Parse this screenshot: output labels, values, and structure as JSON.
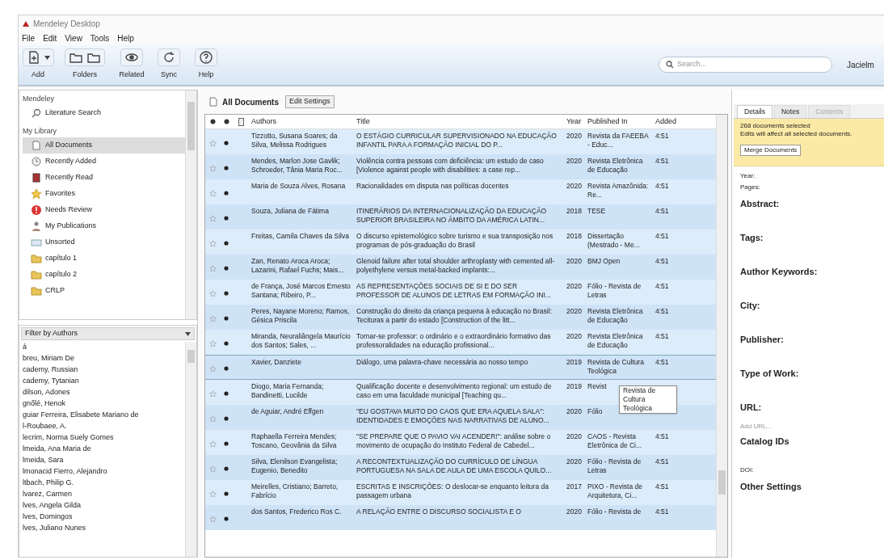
{
  "window": {
    "title": "Mendeley Desktop"
  },
  "menu": [
    "File",
    "Edit",
    "View",
    "Tools",
    "Help"
  ],
  "toolbar": [
    {
      "label": "Add",
      "kind": "add",
      "dropdown": true
    },
    {
      "label": "Folders",
      "kind": "folders"
    },
    {
      "label": "Related",
      "kind": "related"
    },
    {
      "label": "Sync",
      "kind": "sync"
    },
    {
      "label": "Help",
      "kind": "help"
    }
  ],
  "search": {
    "placeholder": "Search..."
  },
  "user": "Jacielm",
  "sidebar": {
    "sections": [
      {
        "title": "Mendeley",
        "items": [
          {
            "label": "Literature Search",
            "kind": "search",
            "selected": false
          }
        ]
      },
      {
        "title": "My Library",
        "items": [
          {
            "label": "All Documents",
            "kind": "docs",
            "selected": true
          },
          {
            "label": "Recently Added",
            "kind": "clock",
            "selected": false
          },
          {
            "label": "Recently Read",
            "kind": "book",
            "selected": false
          },
          {
            "label": "Favorites",
            "kind": "star",
            "selected": false
          },
          {
            "label": "Needs Review",
            "kind": "review",
            "selected": false
          },
          {
            "label": "My Publications",
            "kind": "person",
            "selected": false
          },
          {
            "label": "Unsorted",
            "kind": "unsorted",
            "selected": false
          },
          {
            "label": "capítulo 1",
            "kind": "folder",
            "selected": false
          },
          {
            "label": "capítulo 2",
            "kind": "folder",
            "selected": false
          },
          {
            "label": "CRLP",
            "kind": "folder",
            "selected": false
          }
        ]
      }
    ]
  },
  "filter": {
    "label": "Filter by Authors",
    "items": [
      "á",
      "breu, Miriam De",
      "cademy, Russian",
      "cademy, Tytanian",
      "dilson, Adones",
      "gnőlé, Henok",
      "guiar Ferreira, Elisabete Mariano de",
      "l-Roubaee, A.",
      "lecrim, Norma Suely Gomes",
      "lmeida, Ana Maria de",
      "lmeida, Sara",
      "lmonacid Fierro, Alejandro",
      "ltbach, Philip G.",
      "lvarez, Carmen",
      "lves, Angela Gilda",
      "lves, Domingos",
      "lves, Juliano Nunes"
    ]
  },
  "documents": {
    "title": "All Documents",
    "edit_button": "Edit Settings",
    "columns": [
      "Authors",
      "Title",
      "Year",
      "Published In",
      "Added"
    ],
    "rows": [
      {
        "selected": true,
        "hovered": false,
        "authors": "Tizzotto, Susana Soares; da Silva, Melissa Rodrigues",
        "title": "O ESTÁGIO CURRICULAR SUPERVISIONADO NA EDUCAÇÃO INFANTIL PARA A FORMAÇÃO INICIAL DO P...",
        "year": "2020",
        "published": "Revista da FAEEBA - Educ...",
        "added": "4:51"
      },
      {
        "selected": true,
        "hovered": false,
        "authors": "Mendes, Marlon Jose Gavlik; Schroeder, Tânia Maria Roc...",
        "title": "Violência contra pessoas com deficiência: um estudo de caso [Violence against people with disabilities: a case rep...",
        "year": "2020",
        "published": "Revista Eletrônica de Educação",
        "added": "4:51"
      },
      {
        "selected": true,
        "hovered": false,
        "authors": "Maria de Souza Alves, Rosana",
        "title": "Racionalidades em disputa nas políticas docentes",
        "year": "2020",
        "published": "Revista Amazônida: Re...",
        "added": "4:51"
      },
      {
        "selected": true,
        "hovered": false,
        "authors": "Souza, Juliana de Fátima",
        "title": "ITINERÁRIOS DA INTERNACIONALIZAÇÃO DA EDUCAÇÃO SUPERIOR BRASILEIRA NO ÂMBITO DA AMÉRICA LATIN...",
        "year": "2018",
        "published": "TESE",
        "added": "4:51"
      },
      {
        "selected": true,
        "hovered": false,
        "authors": "Freitas, Camila Chaves da Silva",
        "title": "O discurso epistemológico sobre turismo e sua transposição nos programas de pós-graduação do Brasil",
        "year": "2018",
        "published": "Dissertação (Mestrado - Me...",
        "added": "4:51"
      },
      {
        "selected": true,
        "hovered": false,
        "authors": "Zan, Renato Aroca Aroca; Lazarini, Rafael Fuchs; Mais...",
        "title": "Glenoid failure after total shoulder arthroplasty with cemented all-polyethylene versus metal-backed implants:...",
        "year": "2020",
        "published": "BMJ Open",
        "added": "4:51"
      },
      {
        "selected": true,
        "hovered": false,
        "authors": "de França, José Marcos Ernesto Santana; Ribeiro, P...",
        "title": "AS REPRESENTAÇÕES SOCIAIS DE SI E DO SER PROFESSOR DE ALUNOS DE LETRAS EM FORMAÇÃO INI...",
        "year": "2020",
        "published": "Fólio - Revista de Letras",
        "added": "4:51"
      },
      {
        "selected": true,
        "hovered": false,
        "authors": "Peres, Nayane Moreno; Ramos, Gésica Priscila",
        "title": "Construção do direito da criança pequena à educação no Brasil: Tecituras a partir do estado [Construction of the litt...",
        "year": "2020",
        "published": "Revista Eletrônica de Educação",
        "added": "4:51"
      },
      {
        "selected": true,
        "hovered": false,
        "authors": "Miranda, Neuraliângela Maurício dos Santos; Sales, ...",
        "title": "Tornar-se professor: o ordinário e o extraordinário formativo das professoralidades na educação profissional...",
        "year": "2020",
        "published": "Revista Eletrônica de Educação",
        "added": "4:51"
      },
      {
        "selected": true,
        "hovered": true,
        "authors": "Xavier, Danziete",
        "title": "Diálogo, uma palavra-chave necessária ao nosso tempo",
        "year": "2019",
        "published": "Revista de Cultura Teológica",
        "added": "4:51"
      },
      {
        "selected": true,
        "hovered": false,
        "authors": "Diogo, Maria Fernanda; Bandinetti, Lucilde",
        "title": "Qualificação docente e desenvolvimento regional: um estudo de caso em uma faculdade municipal [Teaching qu...",
        "year": "2019",
        "published": "Revist",
        "tooltip": "Revista de Cultura Teológica"
      },
      {
        "selected": true,
        "hovered": false,
        "authors": "de Aguiar, André Effgen",
        "title": "\"EU GOSTAVA MUITO DO CAOS QUE ERA AQUELA SALA\": IDENTIDADES E EMOÇÕES NAS NARRATIVAS DE ALUNO...",
        "year": "2020",
        "published": "Fólio"
      },
      {
        "selected": true,
        "hovered": false,
        "authors": "Raphaella Ferreira Mendes; Toscano, Geovânia da Silva",
        "title": "\"SE PREPARE QUE O PAVIO VAI ACENDER!\": análise sobre o movimento de ocupação do Instituto Federal de Cabedel...",
        "year": "2020",
        "published": "CAOS - Revista Eletrônica de Ci...",
        "added": "4:51"
      },
      {
        "selected": true,
        "hovered": false,
        "authors": "Silva, Elenilson Evangelista; Eugenio, Benedito",
        "title": "A RECONTEXTUALIZAÇÃO DO CURRÍCULO DE LÍNGUA PORTUGUESA NA SALA DE AULA DE UMA ESCOLA QUILO...",
        "year": "2020",
        "published": "Fólio - Revista de Letras",
        "added": "4:51"
      },
      {
        "selected": true,
        "hovered": false,
        "authors": "Meirelles, Cristiano; Barreto, Fabrício",
        "title": "ESCRITAS E INSCRIÇÕES: O deslocar-se enquanto leitura da passagem urbana",
        "year": "2017",
        "published": "PIXO - Revista de Arquitetura, Ci...",
        "added": "4:51"
      },
      {
        "selected": true,
        "hovered": false,
        "authors": "dos Santos, Frederico Ros C.",
        "title": "A RELAÇÃO ENTRE O DISCURSO SOCIALISTA E O",
        "year": "2020",
        "published": "Fólio - Revista de",
        "added": "4:51"
      }
    ]
  },
  "details": {
    "tabs": [
      {
        "label": "Details",
        "selected": true,
        "disabled": false
      },
      {
        "label": "Notes",
        "selected": false,
        "disabled": false
      },
      {
        "label": "Contents",
        "selected": false,
        "disabled": true
      }
    ],
    "notice": [
      "268 documents selected",
      "Edits will affect all selected documents."
    ],
    "merge_button": "Merge Documents",
    "fields": [
      {
        "label": "Year:",
        "kind": "small"
      },
      {
        "label": "Pages:",
        "kind": "small"
      },
      {
        "label": "Abstract:",
        "kind": "big"
      },
      {
        "label": "Tags:",
        "kind": "big"
      },
      {
        "label": "Author Keywords:",
        "kind": "big"
      },
      {
        "label": "City:",
        "kind": "big"
      },
      {
        "label": "Publisher:",
        "kind": "big"
      },
      {
        "label": "Type of Work:",
        "kind": "big"
      },
      {
        "label": "URL:",
        "kind": "big",
        "placeholder": "Add URL..."
      },
      {
        "label": "Catalog IDs",
        "kind": "big"
      },
      {
        "label": "DOI:",
        "kind": "small"
      },
      {
        "label": "Other Settings",
        "kind": "big"
      }
    ]
  }
}
